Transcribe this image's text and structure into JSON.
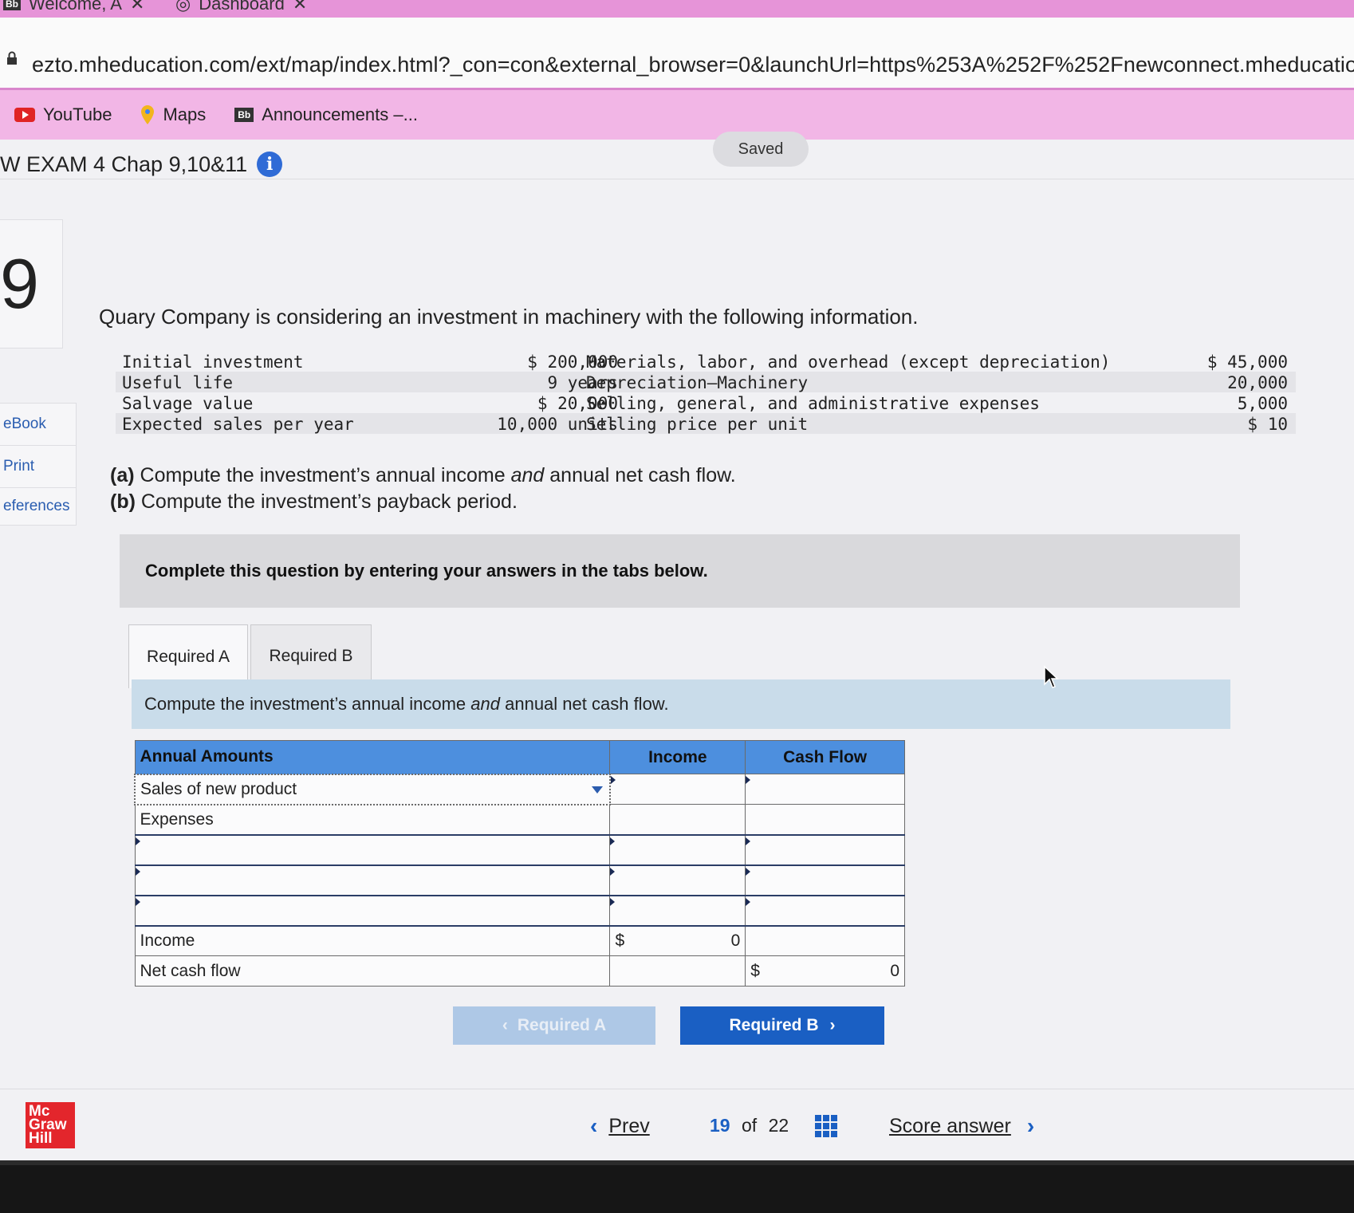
{
  "browser": {
    "tabs": [
      {
        "label": "Welcome, A"
      },
      {
        "label": "Dashboard"
      }
    ],
    "url": "ezto.mheducation.com/ext/map/index.html?_con=con&external_browser=0&launchUrl=https%253A%252F%252Fnewconnect.mheducation.com",
    "bookmarks": [
      {
        "label": "YouTube",
        "icon": "youtube-icon"
      },
      {
        "label": "Maps",
        "icon": "maps-pin-icon"
      },
      {
        "label": "Announcements –...",
        "icon": "blackboard-icon"
      }
    ]
  },
  "header": {
    "exam_title": "W EXAM 4 Chap 9,10&11",
    "saved_label": "Saved"
  },
  "question": {
    "number": "9",
    "side_links": [
      "eBook",
      "Print",
      "eferences"
    ],
    "prompt": "Quary Company is considering an investment in machinery with the following information.",
    "givens": [
      {
        "label": "Initial investment",
        "value": "$ 200,000",
        "label2": "Materials, labor, and overhead (except depreciation)",
        "value2": "$ 45,000"
      },
      {
        "label": "Useful life",
        "value": "9 years",
        "label2": "Depreciation—Machinery",
        "value2": "20,000"
      },
      {
        "label": "Salvage value",
        "value": "$ 20,000",
        "label2": "Selling, general, and administrative expenses",
        "value2": "5,000"
      },
      {
        "label": "Expected sales per year",
        "value": "10,000 units",
        "label2": "Selling price per unit",
        "value2": "$ 10"
      }
    ],
    "part_a_prefix": "(a)",
    "part_a_pre": " Compute the investment’s annual income ",
    "part_a_em": "and",
    "part_a_post": " annual net cash flow.",
    "part_b_prefix": "(b)",
    "part_b_text": " Compute the investment’s payback period."
  },
  "banner": "Complete this question by entering your answers in the tabs below.",
  "tabs": {
    "required_a": "Required A",
    "required_b": "Required B"
  },
  "instruction": {
    "pre": "Compute the investment’s annual income ",
    "em": "and",
    "post": " annual net cash flow."
  },
  "table": {
    "headers": {
      "amounts": "Annual Amounts",
      "income": "Income",
      "cash_flow": "Cash Flow"
    },
    "sales_row": "Sales of new product",
    "expenses_row": "Expenses",
    "income_row": "Income",
    "net_cash_row": "Net cash flow",
    "currency": "$",
    "income_total": "0",
    "cash_flow_total": "0"
  },
  "nav_buttons": {
    "prev_label": "Required A",
    "next_label": "Required B"
  },
  "footer": {
    "logo_lines": [
      "Mc",
      "Graw",
      "Hill"
    ],
    "prev_label": "Prev",
    "current_page": "19",
    "of_label": "of",
    "total_pages": "22",
    "score_label": "Score answer"
  }
}
